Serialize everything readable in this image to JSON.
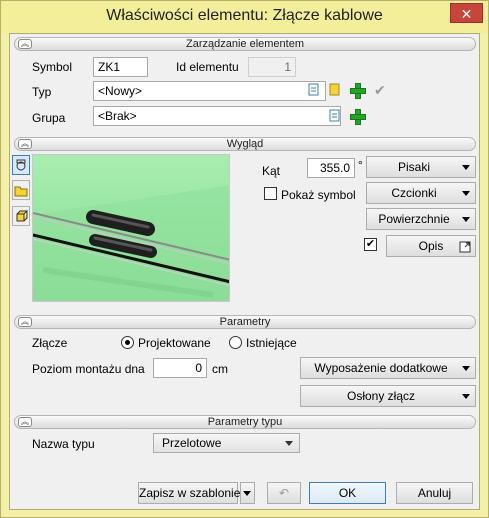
{
  "window": {
    "title": "Właściwości elementu: Złącze kablowe",
    "close_glyph": "✕"
  },
  "sections": {
    "management": "Zarządzanie elementem",
    "appearance": "Wygląd",
    "parameters": "Parametry",
    "type_parameters": "Parametry typu"
  },
  "management": {
    "symbol_label": "Symbol",
    "symbol_value": "ZK1",
    "id_label": "Id elementu",
    "id_value": "1",
    "type_label": "Typ",
    "type_value": "<Nowy>",
    "group_label": "Grupa",
    "group_value": "<Brak>"
  },
  "appearance": {
    "angle_label": "Kąt",
    "angle_value": "355.0",
    "angle_unit": "°",
    "pens_button": "Pisaki",
    "show_symbol_label": "Pokaż symbol",
    "show_symbol_checked": false,
    "fonts_button": "Czcionki",
    "surfaces_button": "Powierzchnie",
    "description_checked": true,
    "description_button": "Opis"
  },
  "parameters": {
    "joint_label": "Złącze",
    "option_designed": "Projektowane",
    "option_existing": "Istniejące",
    "selected": "Projektowane",
    "mount_level_label": "Poziom montażu dna",
    "mount_level_value": "0",
    "mount_level_unit": "cm",
    "extra_equipment_button": "Wyposażenie dodatkowe",
    "joint_covers_button": "Osłony złącz"
  },
  "type_parameters": {
    "type_name_label": "Nazwa typu",
    "type_name_value": "Przelotowe"
  },
  "footer": {
    "save_template_button": "Zapisz w szablonie",
    "ok_button": "OK",
    "cancel_button": "Anuluj"
  },
  "colors": {
    "accent": "#3c7fb1",
    "add_green": "#27a327",
    "preview_bg": "#9be6a6",
    "title_bar": "#f3ee9a"
  }
}
